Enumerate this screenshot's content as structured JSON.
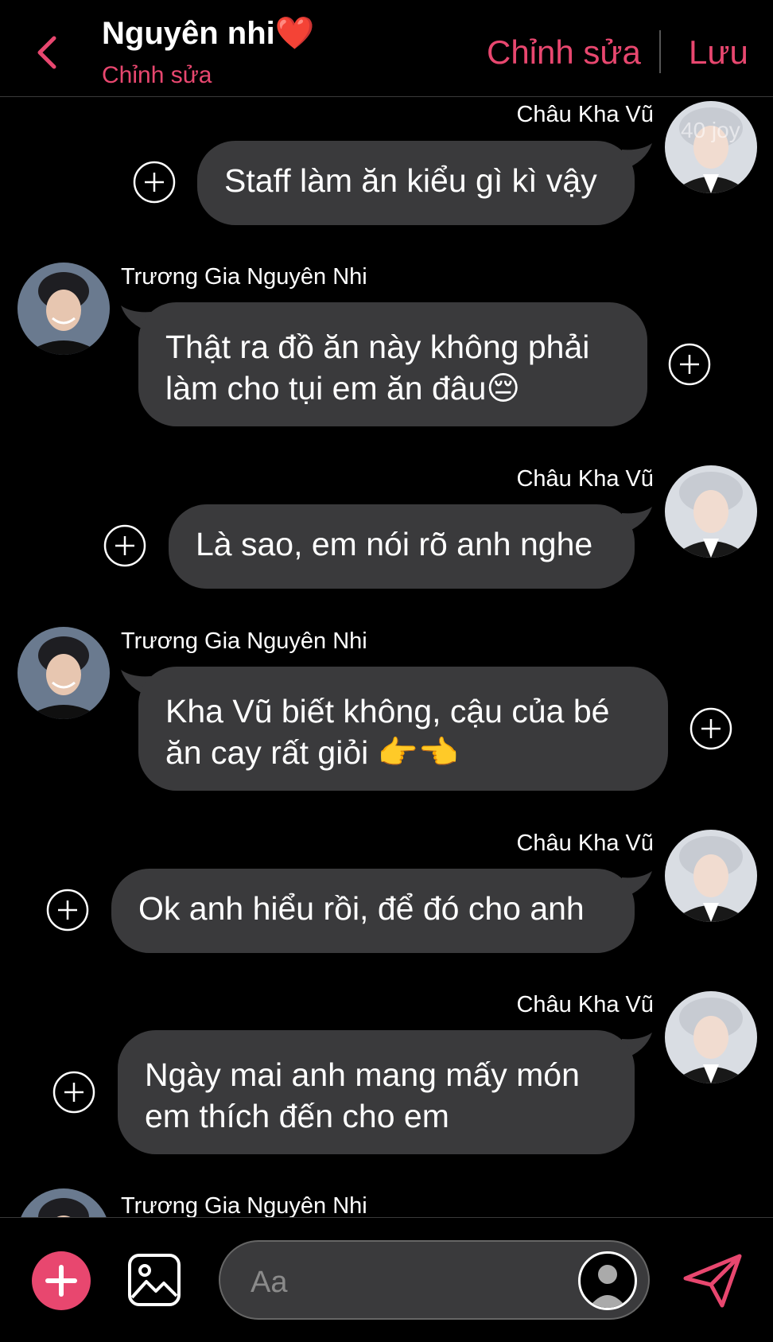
{
  "header": {
    "title": "Nguyên nhi❤️",
    "subtitle": "Chỉnh sửa",
    "edit_label": "Chỉnh sửa",
    "save_label": "Lưu"
  },
  "watermark": "40 joy",
  "messages": [
    {
      "sender": "Châu Kha Vũ",
      "side": "right",
      "text": "Staff làm ăn kiểu gì kì vậy"
    },
    {
      "sender": "Trương Gia Nguyên Nhi",
      "side": "left",
      "text": "Thật ra đồ ăn này không phải làm cho tụi em ăn đâu😔"
    },
    {
      "sender": "Châu Kha Vũ",
      "side": "right",
      "text": "Là sao, em nói rõ anh nghe"
    },
    {
      "sender": "Trương Gia Nguyên Nhi",
      "side": "left",
      "text": "Kha Vũ biết không, cậu của bé ăn cay rất giỏi 👉👈"
    },
    {
      "sender": "Châu Kha Vũ",
      "side": "right",
      "text": "Ok anh hiểu rồi, để đó cho anh"
    },
    {
      "sender": "Châu Kha Vũ",
      "side": "right",
      "text": "Ngày mai anh mang mấy món em thích đến cho em"
    },
    {
      "sender": "Trương Gia Nguyên Nhi",
      "side": "left",
      "text": ""
    }
  ],
  "composer": {
    "placeholder": "Aa"
  },
  "colors": {
    "accent": "#e8476f",
    "bubble": "#3a3a3c",
    "background": "#000000"
  }
}
